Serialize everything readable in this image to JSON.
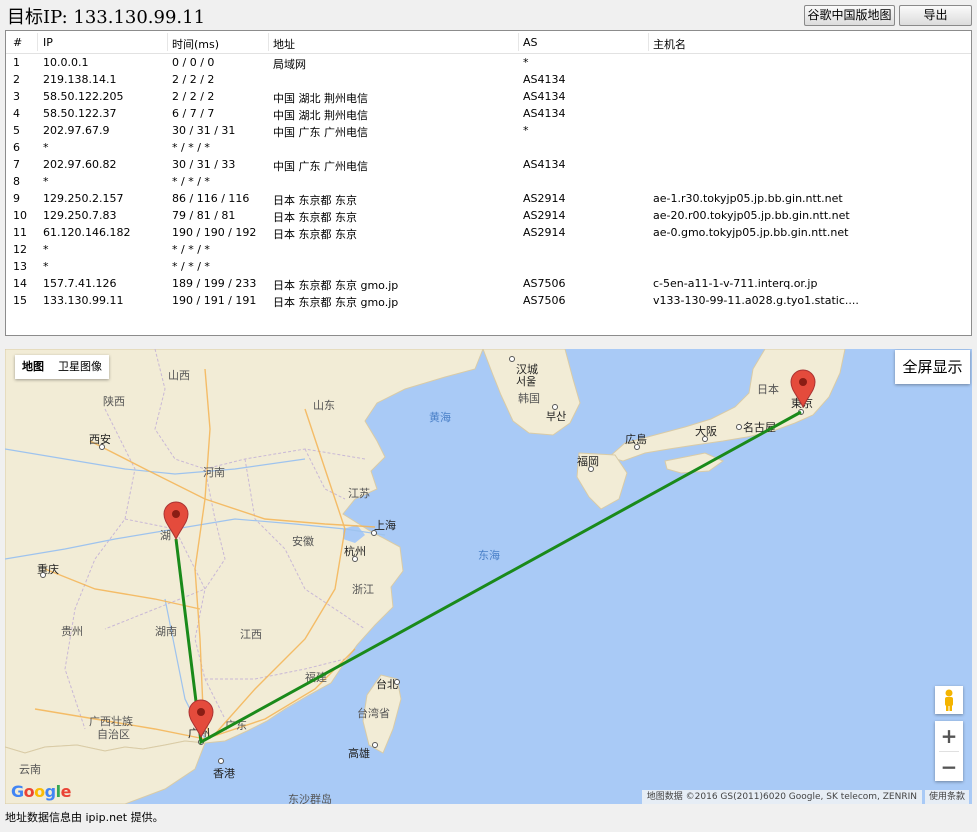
{
  "title": "目标IP: 133.130.99.11",
  "buttons": {
    "map": "谷歌中国版地图",
    "export": "导出"
  },
  "table": {
    "headers": [
      "#",
      "IP",
      "时间(ms)",
      "地址",
      "AS",
      "主机名"
    ],
    "rows": [
      [
        "1",
        "10.0.0.1",
        "0 / 0 / 0",
        "局域网",
        "*",
        ""
      ],
      [
        "2",
        "219.138.14.1",
        "2 / 2 / 2",
        "",
        "AS4134",
        ""
      ],
      [
        "3",
        "58.50.122.205",
        "2 / 2 / 2",
        "中国 湖北 荆州电信",
        "AS4134",
        ""
      ],
      [
        "4",
        "58.50.122.37",
        "6 / 7 / 7",
        "中国 湖北 荆州电信",
        "AS4134",
        ""
      ],
      [
        "5",
        "202.97.67.9",
        "30 / 31 / 31",
        "中国 广东 广州电信",
        "*",
        ""
      ],
      [
        "6",
        "*",
        "* / * / *",
        "",
        "",
        ""
      ],
      [
        "7",
        "202.97.60.82",
        "30 / 31 / 33",
        "中国 广东 广州电信",
        "AS4134",
        ""
      ],
      [
        "8",
        "*",
        "* / * / *",
        "",
        "",
        ""
      ],
      [
        "9",
        "129.250.2.157",
        "86 / 116 / 116",
        "日本 东京都 东京",
        "AS2914",
        "ae-1.r30.tokyjp05.jp.bb.gin.ntt.net"
      ],
      [
        "10",
        "129.250.7.83",
        "79 / 81 / 81",
        "日本 东京都 东京",
        "AS2914",
        "ae-20.r00.tokyjp05.jp.bb.gin.ntt.net"
      ],
      [
        "11",
        "61.120.146.182",
        "190 / 190 / 192",
        "日本 东京都 东京",
        "AS2914",
        "ae-0.gmo.tokyjp05.jp.bb.gin.ntt.net"
      ],
      [
        "12",
        "*",
        "* / * / *",
        "",
        "",
        ""
      ],
      [
        "13",
        "*",
        "* / * / *",
        "",
        "",
        ""
      ],
      [
        "14",
        "157.7.41.126",
        "189 / 199 / 233",
        "日本 东京都 东京 gmo.jp",
        "AS7506",
        "c-5en-a11-1-v-711.interq.or.jp"
      ],
      [
        "15",
        "133.130.99.11",
        "190 / 191 / 191",
        "日本 东京都 东京 gmo.jp",
        "AS7506",
        "v133-130-99-11.a028.g.tyo1.static...."
      ]
    ]
  },
  "map": {
    "map_type": {
      "map": "地图",
      "satellite": "卫星图像"
    },
    "fullscreen": "全屏显示",
    "zoom_in": "+",
    "zoom_out": "−",
    "attribution": "地图数据 ©2016 GS(2011)6020 Google, SK telecom, ZENRIN",
    "terms": "使用条款",
    "logo": "Google",
    "route_color": "#1a8a1a",
    "marker_color": "#e44b3c",
    "labels": {
      "shanxi": "山西",
      "shaanxi": "陕西",
      "xian": "西安",
      "shandong": "山东",
      "henan": "河南",
      "jiangsu": "江苏",
      "shanghai": "上海",
      "anhui": "安徽",
      "hangzhou": "杭州",
      "zhejiang": "浙江",
      "chongqing": "重庆",
      "hubei": "湖",
      "hunan": "湖南",
      "jiangxi": "江西",
      "guizhou": "贵州",
      "fujian": "福建",
      "guangxi": "广西壮族",
      "guangxi2": "自治区",
      "guangzhou": "广州",
      "guangdong": "广东",
      "hongkong": "香港",
      "taibei": "台北",
      "taiwan": "台湾省",
      "gaoxiong": "高雄",
      "yunnan": "云南",
      "seoul": "汉城",
      "seoul2": "서울",
      "korea": "韩国",
      "busan": "부산",
      "yellowsea": "黄海",
      "eastsea": "东海",
      "japan": "日本",
      "tokyo": "東京",
      "hiroshima": "広島",
      "osaka": "大阪",
      "nagoya": "名古屋",
      "fukuoka": "福岡",
      "dongsha": "东沙群岛",
      "partial": "云"
    }
  },
  "footer": "地址数据信息由 ipip.net 提供。"
}
